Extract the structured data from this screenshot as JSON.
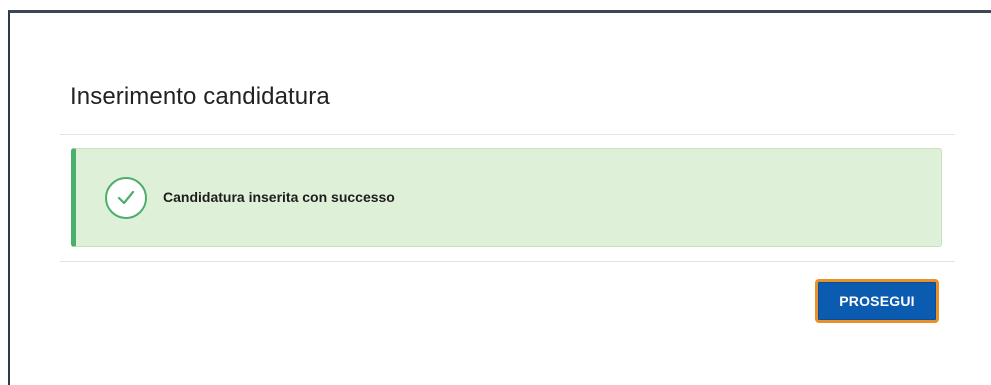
{
  "page": {
    "title": "Inserimento candidatura"
  },
  "alert": {
    "type": "success",
    "icon": "check-circle-icon",
    "message": "Candidatura inserita con successo"
  },
  "actions": {
    "continue_label": "PROSEGUI"
  },
  "colors": {
    "success_accent": "#4cae6b",
    "success_background": "#dff0d8",
    "primary_button": "#0b5bb0",
    "focus_outline": "#e8912d"
  }
}
